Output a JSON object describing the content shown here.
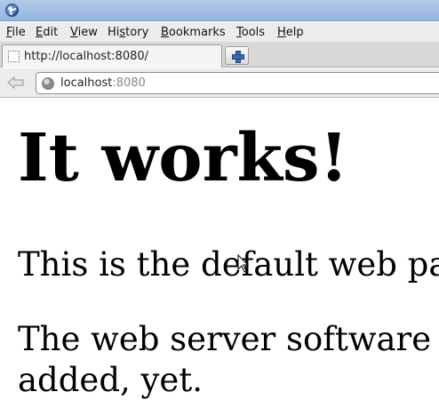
{
  "window": {
    "app_icon": "firefox-icon"
  },
  "menubar": {
    "items": [
      {
        "underline": "F",
        "rest": "ile"
      },
      {
        "underline": "E",
        "rest": "dit"
      },
      {
        "underline": "V",
        "rest": "iew"
      },
      {
        "pre": "Hi",
        "underline": "s",
        "rest": "tory"
      },
      {
        "underline": "B",
        "rest": "ookmarks"
      },
      {
        "underline": "T",
        "rest": "ools"
      },
      {
        "underline": "H",
        "rest": "elp"
      }
    ]
  },
  "tabs": {
    "active_label": "http://localhost:8080/",
    "new_tab_icon": "plus-icon"
  },
  "navigation": {
    "back_icon": "back-arrow-icon",
    "url_host": "localhost",
    "url_port": ":8080",
    "site_icon": "globe-icon"
  },
  "page": {
    "heading": "It works!",
    "paragraph1": "This is the default web page for this server.",
    "paragraph2_line1": "The web server software is running but no content has been",
    "paragraph2_line2": "added, yet."
  }
}
